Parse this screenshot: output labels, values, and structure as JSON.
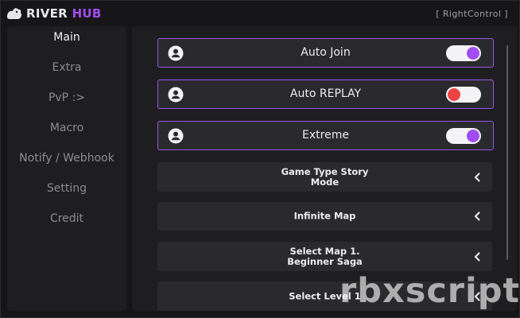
{
  "header": {
    "title_main": "RIVER",
    "title_accent": "HUB",
    "keybind": "[ RightControl ]"
  },
  "sidebar": {
    "items": [
      {
        "label": "Main",
        "active": true
      },
      {
        "label": "Extra",
        "active": false
      },
      {
        "label": "PvP :>",
        "active": false
      },
      {
        "label": "Macro",
        "active": false
      },
      {
        "label": "Notify / Webhook",
        "active": false
      },
      {
        "label": "Setting",
        "active": false
      },
      {
        "label": "Credit",
        "active": false
      }
    ]
  },
  "main": {
    "toggles": [
      {
        "label": "Auto Join",
        "state": "on"
      },
      {
        "label": "Auto REPLAY",
        "state": "off"
      },
      {
        "label": "Extreme",
        "state": "on"
      }
    ],
    "dropdowns": [
      {
        "label": "Game Type Story\nMode"
      },
      {
        "label": "Infinite Map"
      },
      {
        "label": "Select Map 1.\nBeginner Saga"
      },
      {
        "label": "Select Level 1"
      }
    ]
  },
  "watermark": "rbxscript",
  "icons": {
    "row_icon": "user-circle-icon",
    "dropdown_icon": "chevron-left-icon",
    "logo": "hub-logo-icon"
  },
  "colors": {
    "accent": "#a24df3",
    "toggle_off_knob": "#ef4343",
    "panel": "#1e1e21",
    "row": "#2a2a2e"
  }
}
